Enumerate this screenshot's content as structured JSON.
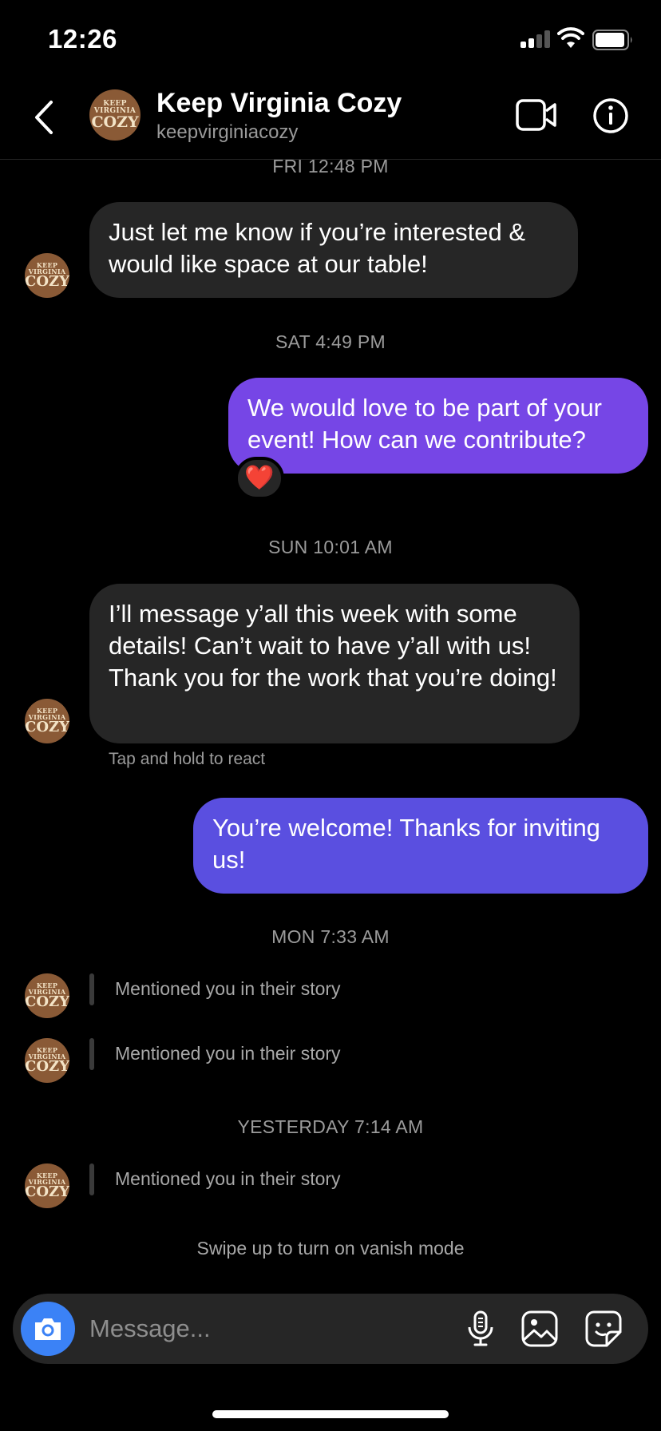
{
  "status_bar": {
    "time": "12:26"
  },
  "header": {
    "title": "Keep Virginia Cozy",
    "username": "keepvirginiacozy",
    "avatar_top": "KEEP",
    "avatar_mid": "VIRGINIA",
    "avatar_bottom": "COZY"
  },
  "colors": {
    "outgoing_bubble_1": "#7646e6",
    "outgoing_bubble_2": "#5a4fe0",
    "incoming_bubble": "#262626",
    "camera_button": "#3b82f6"
  },
  "messages": {
    "ts_1": "FRI 12:48 PM",
    "msg_1": "Just let me know if you’re interested & would like space at our table!",
    "ts_2": "SAT 4:49 PM",
    "msg_2": "We would love to be part of your event! How can we contribute?",
    "msg_2_reaction": "❤️",
    "ts_3": "SUN 10:01 AM",
    "msg_3": "I’ll message y’all this week with some details! Can’t wait to have y’all with us! Thank you for the work that you’re doing!",
    "msg_3_hint": "Tap and hold to react",
    "msg_4": "You’re welcome! Thanks for inviting us!",
    "ts_4": "MON 7:33 AM",
    "mention_1": "Mentioned you in their story",
    "mention_2": "Mentioned you in their story",
    "ts_5": "YESTERDAY 7:14 AM",
    "mention_3": "Mentioned you in their story",
    "vanish_hint": "Swipe up to turn on vanish mode"
  },
  "composer": {
    "placeholder": "Message...",
    "icons": [
      "camera-icon",
      "microphone-icon",
      "gallery-icon",
      "sticker-icon"
    ]
  }
}
